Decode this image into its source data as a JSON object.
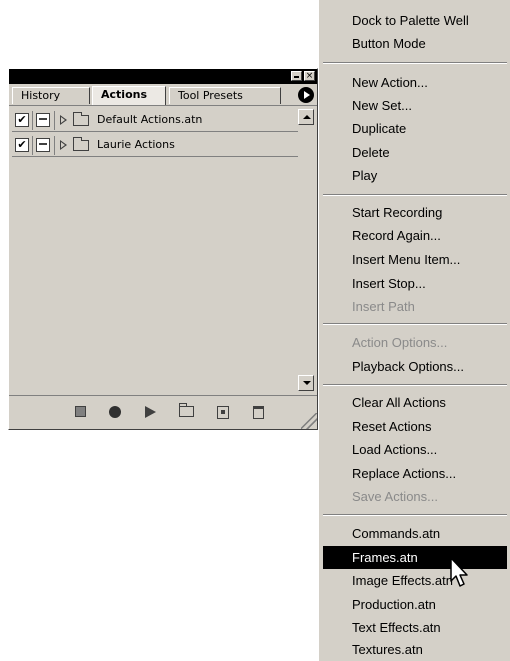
{
  "palette": {
    "tabs": [
      {
        "label": "History"
      },
      {
        "label": "Actions"
      },
      {
        "label": "Tool Presets"
      }
    ],
    "active_tab": "Actions",
    "rows": [
      {
        "label": "Default Actions.atn",
        "checked": true
      },
      {
        "label": "Laurie Actions",
        "checked": true
      }
    ],
    "bottom_icons": [
      "stop-icon",
      "record-icon",
      "play-icon",
      "new-set-icon",
      "new-action-icon",
      "trash-icon"
    ]
  },
  "menu": {
    "groups": [
      {
        "items": [
          {
            "label": "Dock to Palette Well",
            "enabled": true
          },
          {
            "label": "Button Mode",
            "enabled": true
          }
        ]
      },
      {
        "items": [
          {
            "label": "New Action...",
            "enabled": true
          },
          {
            "label": "New Set...",
            "enabled": true
          },
          {
            "label": "Duplicate",
            "enabled": true
          },
          {
            "label": "Delete",
            "enabled": true
          },
          {
            "label": "Play",
            "enabled": true
          }
        ]
      },
      {
        "items": [
          {
            "label": "Start Recording",
            "enabled": true
          },
          {
            "label": "Record Again...",
            "enabled": true
          },
          {
            "label": "Insert Menu Item...",
            "enabled": true
          },
          {
            "label": "Insert Stop...",
            "enabled": true
          },
          {
            "label": "Insert Path",
            "enabled": false
          }
        ]
      },
      {
        "items": [
          {
            "label": "Action Options...",
            "enabled": false
          },
          {
            "label": "Playback Options...",
            "enabled": true
          }
        ]
      },
      {
        "items": [
          {
            "label": "Clear All Actions",
            "enabled": true
          },
          {
            "label": "Reset Actions",
            "enabled": true
          },
          {
            "label": "Load Actions...",
            "enabled": true
          },
          {
            "label": "Replace Actions...",
            "enabled": true
          },
          {
            "label": "Save Actions...",
            "enabled": false
          }
        ]
      },
      {
        "items": [
          {
            "label": "Commands.atn",
            "enabled": true
          },
          {
            "label": "Frames.atn",
            "enabled": true,
            "highlighted": true
          },
          {
            "label": "Image Effects.atn",
            "enabled": true
          },
          {
            "label": "Production.atn",
            "enabled": true
          },
          {
            "label": "Text Effects.atn",
            "enabled": true
          },
          {
            "label": "Textures.atn",
            "enabled": true
          }
        ]
      }
    ]
  },
  "colors": {
    "chrome": "#d4d0c8",
    "highlight_bg": "#000000",
    "disabled_text": "#8a8a8a"
  }
}
